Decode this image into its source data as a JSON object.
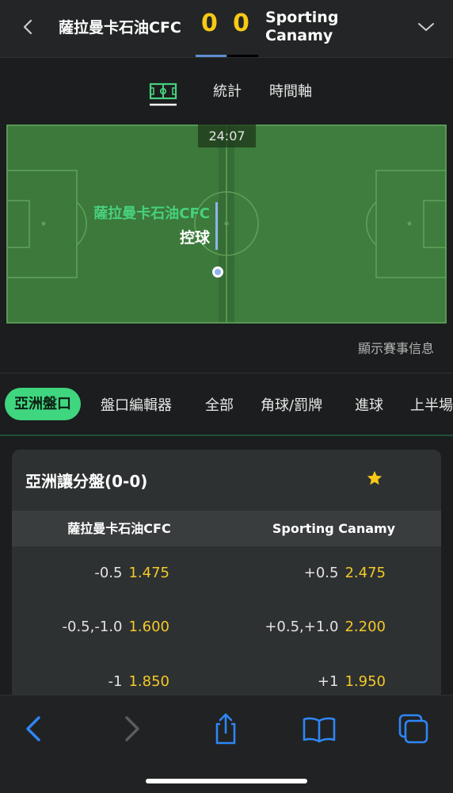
{
  "header": {
    "home_team": "薩拉曼卡石油CFC",
    "home_score": "0",
    "away_score": "0",
    "away_team": "Sporting Canamy",
    "back_icon": "chevron-left-icon",
    "expand_icon": "chevron-down-icon",
    "accent_color": "#f6c915"
  },
  "view_tabs": {
    "pitch_icon": "pitch-icon",
    "stats": "統計",
    "timeline": "時間軸"
  },
  "pitch": {
    "clock": "24:07",
    "possession_team": "薩拉曼卡石油CFC",
    "possession_label": "控球",
    "pitch_color": "#3d7b3c",
    "possession_color": "#48d07d"
  },
  "match_info_link": "顯示賽事信息",
  "market_tabs": [
    {
      "label": "亞洲盤口",
      "active": true
    },
    {
      "label": "盤口編輯器",
      "active": false
    },
    {
      "label": "全部",
      "active": false
    },
    {
      "label": "角球/罰牌",
      "active": false
    },
    {
      "label": "進球",
      "active": false
    },
    {
      "label": "上半場",
      "active": false
    }
  ],
  "odds_card": {
    "title": "亞洲讓分盤(0-0)",
    "favorite_icon": "star-icon",
    "home_header": "薩拉曼卡石油CFC",
    "away_header": "Sporting Canamy",
    "rows": [
      {
        "home_line": "-0.5",
        "home_price": "1.475",
        "away_line": "+0.5",
        "away_price": "2.475"
      },
      {
        "home_line": "-0.5,-1.0",
        "home_price": "1.600",
        "away_line": "+0.5,+1.0",
        "away_price": "2.200"
      },
      {
        "home_line": "-1",
        "home_price": "1.850",
        "away_line": "+1",
        "away_price": "1.950"
      }
    ],
    "price_color": "#f4c928"
  },
  "bottom_bar": {
    "icons": [
      "back-arrow-icon",
      "forward-arrow-icon",
      "share-icon",
      "bookmarks-icon",
      "tabs-icon"
    ],
    "active_color": "#2f86f6"
  }
}
